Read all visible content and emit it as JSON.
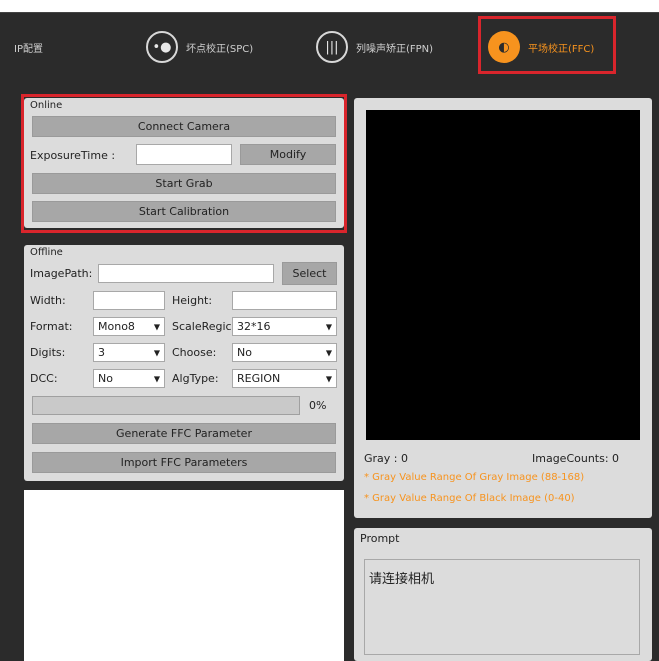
{
  "tabs": [
    {
      "label": "IP配置",
      "icon": "network-icon",
      "active": false
    },
    {
      "label": "坏点校正(SPC)",
      "icon": "dot-icon",
      "active": false
    },
    {
      "label": "列噪声矫正(FPN)",
      "icon": "columns-icon",
      "active": false
    },
    {
      "label": "平场校正(FFC)",
      "icon": "sun-icon",
      "active": true
    }
  ],
  "online": {
    "title": "Online",
    "connect_label": "Connect Camera",
    "exposure_label": "ExposureTime :",
    "exposure_value": "",
    "modify_label": "Modify",
    "start_grab_label": "Start Grab",
    "start_calib_label": "Start Calibration"
  },
  "offline": {
    "title": "Offline",
    "imagepath_label": "ImagePath:",
    "imagepath_value": "",
    "select_label": "Select",
    "width_label": "Width:",
    "height_label": "Height:",
    "format_label": "Format:",
    "format_value": "Mono8",
    "scaleregion_label": "ScaleRegic",
    "scaleregion_value": "32*16",
    "digits_label": "Digits:",
    "digits_value": "3",
    "choose_label": "Choose:",
    "choose_value": "No",
    "dcc_label": "DCC:",
    "dcc_value": "No",
    "algtype_label": "AlgType:",
    "algtype_value": "REGION",
    "progress_percent": "0%",
    "progress_fraction": 0,
    "generate_label": "Generate FFC Parameter",
    "import_label": "Import FFC Parameters"
  },
  "display": {
    "gray_text": "Gray : 0",
    "counts_text": "ImageCounts: 0",
    "note1": "* Gray Value Range Of Gray Image (88-168)",
    "note2": "* Gray Value Range Of Black Image (0-40)"
  },
  "prompt": {
    "title": "Prompt",
    "message": "请连接相机"
  },
  "colors": {
    "accent": "#f7931e",
    "highlight": "#d9252c",
    "dark_bg": "#2b2b2b",
    "panel_bg": "#dcdcdc"
  }
}
